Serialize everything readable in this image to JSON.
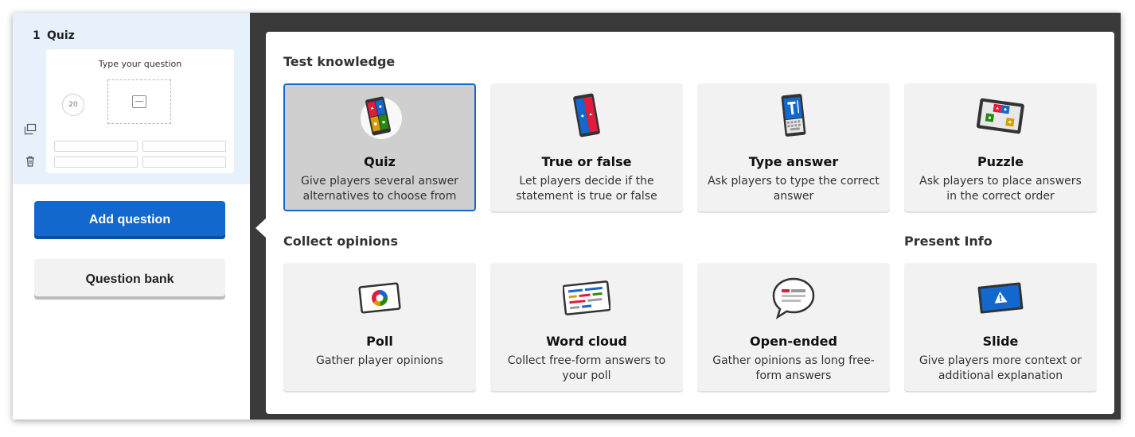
{
  "slide": {
    "number": "1",
    "type": "Quiz",
    "question_placeholder": "Type your question",
    "timer": "20"
  },
  "buttons": {
    "add_question": "Add question",
    "question_bank": "Question bank"
  },
  "sections": {
    "test_knowledge": "Test knowledge",
    "collect_opinions": "Collect opinions",
    "present_info": "Present Info"
  },
  "cards": [
    {
      "title": "Quiz",
      "desc": "Give players several answer alternatives to choose from",
      "icon": "quiz-icon",
      "selected": true
    },
    {
      "title": "True or false",
      "desc": "Let players decide if the statement is true or false",
      "icon": "true-false-icon"
    },
    {
      "title": "Type answer",
      "desc": "Ask players to type the correct answer",
      "icon": "type-answer-icon"
    },
    {
      "title": "Puzzle",
      "desc": "Ask players to place answers in the correct order",
      "icon": "puzzle-icon"
    },
    {
      "title": "Poll",
      "desc": "Gather player opinions",
      "icon": "poll-icon"
    },
    {
      "title": "Word cloud",
      "desc": "Collect free-form answers to your poll",
      "icon": "word-cloud-icon"
    },
    {
      "title": "Open-ended",
      "desc": "Gather opinions as long free-form answers",
      "icon": "open-ended-icon"
    },
    {
      "title": "Slide",
      "desc": "Give players more context or additional explanation",
      "icon": "slide-icon"
    }
  ],
  "colors": {
    "primary": "#1368ce",
    "red": "#e21b3c",
    "blue": "#1368ce",
    "yellow": "#d89e00",
    "green": "#26890c"
  }
}
